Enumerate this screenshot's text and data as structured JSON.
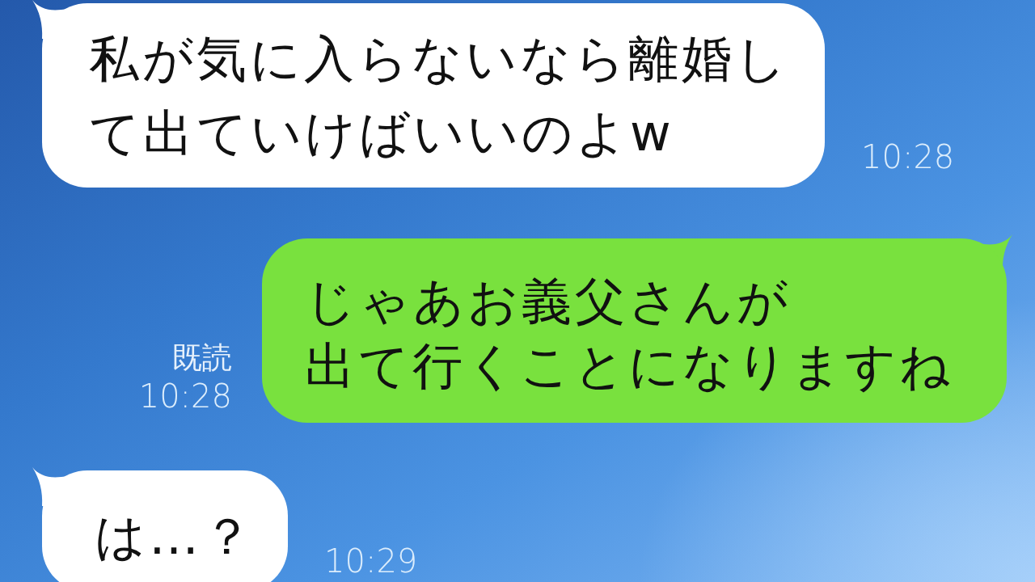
{
  "messages": [
    {
      "kind": "incoming",
      "text_lines": [
        "私が気に入らないなら離婚し",
        "て出ていけばいいのよw"
      ],
      "time": "10:28"
    },
    {
      "kind": "outgoing",
      "read_label": "既読",
      "text_lines": [
        "じゃあお義父さんが",
        "出て行くことになりますね"
      ],
      "time": "10:28"
    },
    {
      "kind": "incoming",
      "text_lines": [
        "は…？"
      ],
      "time": "10:29"
    }
  ]
}
